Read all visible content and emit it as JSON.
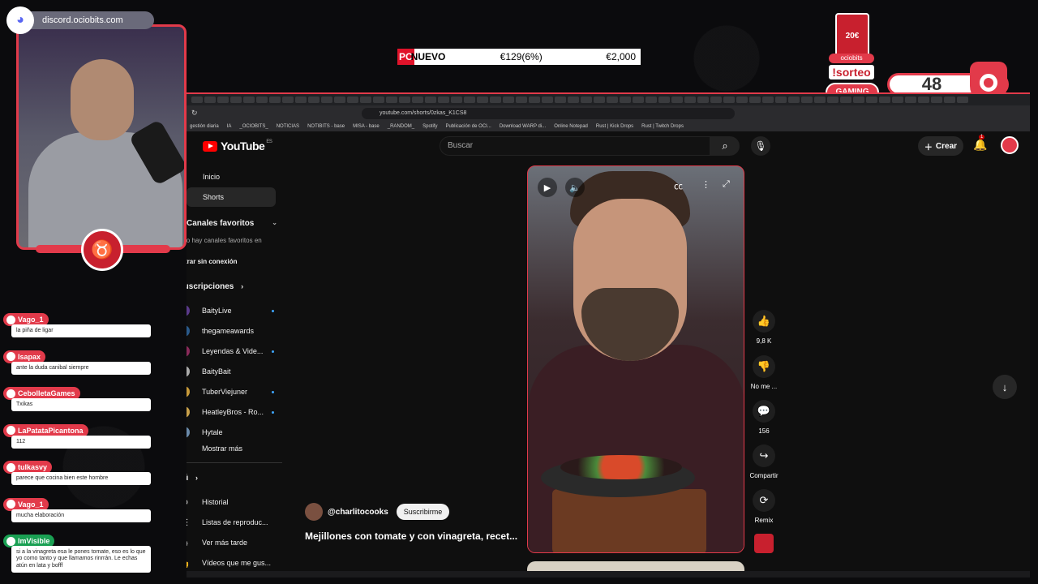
{
  "overlay": {
    "discord_url": "discord.ociobits.com",
    "ticker": {
      "tag": "PC",
      "name": "NUEVO",
      "price": "€129(6%)",
      "price2": "€2,000"
    },
    "sorteo_card": "20€",
    "sorteo_brand": "ociobits",
    "sorteo_label": "!sorteo",
    "gaming_label": "GAMING",
    "counter": "48",
    "colors": {
      "accent": "#e23a4a",
      "discord": "#5865f2"
    }
  },
  "browser": {
    "url": "youtube.com/shorts/0zkas_K1CS8",
    "bookmarks": [
      "gestión diaria",
      "IA",
      "_OCIOBITS_",
      "NOTICIAS",
      "NOTIBITS - base",
      "MISA - base",
      "_RANDOM_",
      "Spotify",
      "Publicación de OCI...",
      "Download WARP di...",
      "Online Notepad",
      "Rust | Kick Drops",
      "Rust | Twitch Drops"
    ]
  },
  "youtube": {
    "logo_text": "YouTube",
    "logo_region": "ES",
    "search_placeholder": "Buscar",
    "create_label": "Crear",
    "notification_count": "1",
    "sidebar": {
      "home": "Inicio",
      "shorts": "Shorts",
      "favorites_heading": "Canales favoritos",
      "favorites_empty": "No hay canales favoritos en",
      "offline": "Mostrar sin conexión",
      "subscriptions_heading": "Suscripciones",
      "subscriptions": [
        {
          "name": "BaityLive",
          "color": "#5a3a8a",
          "new": true
        },
        {
          "name": "thegameawards",
          "color": "#2a5a8a",
          "new": false
        },
        {
          "name": "Leyendas & Vide...",
          "color": "#8a2a5a",
          "new": true
        },
        {
          "name": "BaityBait",
          "color": "#aaaaaa",
          "new": false
        },
        {
          "name": "TuberViejuner",
          "color": "#c89a3a",
          "new": true
        },
        {
          "name": "HeatleyBros - Ro...",
          "color": "#c8a04a",
          "new": true
        },
        {
          "name": "Hytale",
          "color": "#6a8aaa",
          "new": false
        }
      ],
      "show_more": "Mostrar más",
      "you_heading": "Tú",
      "library": [
        {
          "label": "Historial",
          "icon": "history-icon",
          "glyph": "⟲"
        },
        {
          "label": "Listas de reproduc...",
          "icon": "playlist-icon",
          "glyph": "☰"
        },
        {
          "label": "Ver más tarde",
          "icon": "clock-icon",
          "glyph": "◷"
        },
        {
          "label": "Vídeos que me gus...",
          "icon": "thumbs-up-icon",
          "glyph": "👍"
        }
      ]
    },
    "short": {
      "channel": "@charlitocooks",
      "subscribe_label": "Suscribirme",
      "title": "Mejillones con tomate y con vinagreta, recet...",
      "likes": "9,8 K",
      "dislike_label": "No me ...",
      "comments": "156",
      "share_label": "Compartir",
      "remix_label": "Remix"
    }
  },
  "chat": [
    {
      "user": "Vago_1",
      "text": "la piña de ligar",
      "badge": "red"
    },
    {
      "user": "Isapax",
      "text": "ante la duda canibal siempre",
      "badge": "red"
    },
    {
      "user": "CebolletaGames",
      "text": "Txikas",
      "badge": "red"
    },
    {
      "user": "LaPatataPicantona",
      "text": "112",
      "badge": "red"
    },
    {
      "user": "tulkasvy",
      "text": "parece que cocina bien este hombre",
      "badge": "red"
    },
    {
      "user": "Vago_1",
      "text": "mucha elaboración",
      "badge": "red"
    },
    {
      "user": "ImVisible",
      "text": "si a la vinagreta esa le pones tomate, eso es lo que yo como tanto y que llamamos rinrrán. Le echas atún en lata y bofff",
      "badge": "green"
    }
  ]
}
